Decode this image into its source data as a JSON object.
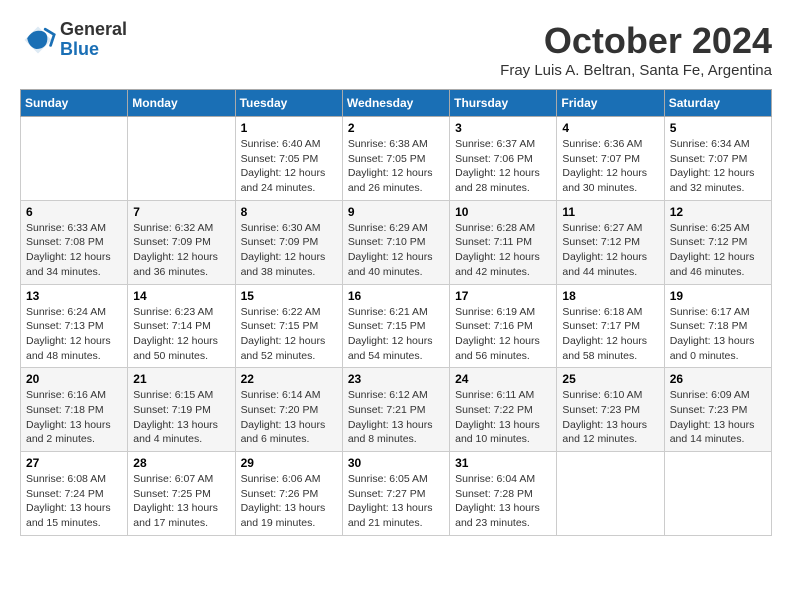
{
  "logo": {
    "general": "General",
    "blue": "Blue"
  },
  "title": "October 2024",
  "location": "Fray Luis A. Beltran, Santa Fe, Argentina",
  "days_of_week": [
    "Sunday",
    "Monday",
    "Tuesday",
    "Wednesday",
    "Thursday",
    "Friday",
    "Saturday"
  ],
  "weeks": [
    [
      {
        "day": null
      },
      {
        "day": null
      },
      {
        "day": "1",
        "sunrise": "Sunrise: 6:40 AM",
        "sunset": "Sunset: 7:05 PM",
        "daylight": "Daylight: 12 hours and 24 minutes."
      },
      {
        "day": "2",
        "sunrise": "Sunrise: 6:38 AM",
        "sunset": "Sunset: 7:05 PM",
        "daylight": "Daylight: 12 hours and 26 minutes."
      },
      {
        "day": "3",
        "sunrise": "Sunrise: 6:37 AM",
        "sunset": "Sunset: 7:06 PM",
        "daylight": "Daylight: 12 hours and 28 minutes."
      },
      {
        "day": "4",
        "sunrise": "Sunrise: 6:36 AM",
        "sunset": "Sunset: 7:07 PM",
        "daylight": "Daylight: 12 hours and 30 minutes."
      },
      {
        "day": "5",
        "sunrise": "Sunrise: 6:34 AM",
        "sunset": "Sunset: 7:07 PM",
        "daylight": "Daylight: 12 hours and 32 minutes."
      }
    ],
    [
      {
        "day": "6",
        "sunrise": "Sunrise: 6:33 AM",
        "sunset": "Sunset: 7:08 PM",
        "daylight": "Daylight: 12 hours and 34 minutes."
      },
      {
        "day": "7",
        "sunrise": "Sunrise: 6:32 AM",
        "sunset": "Sunset: 7:09 PM",
        "daylight": "Daylight: 12 hours and 36 minutes."
      },
      {
        "day": "8",
        "sunrise": "Sunrise: 6:30 AM",
        "sunset": "Sunset: 7:09 PM",
        "daylight": "Daylight: 12 hours and 38 minutes."
      },
      {
        "day": "9",
        "sunrise": "Sunrise: 6:29 AM",
        "sunset": "Sunset: 7:10 PM",
        "daylight": "Daylight: 12 hours and 40 minutes."
      },
      {
        "day": "10",
        "sunrise": "Sunrise: 6:28 AM",
        "sunset": "Sunset: 7:11 PM",
        "daylight": "Daylight: 12 hours and 42 minutes."
      },
      {
        "day": "11",
        "sunrise": "Sunrise: 6:27 AM",
        "sunset": "Sunset: 7:12 PM",
        "daylight": "Daylight: 12 hours and 44 minutes."
      },
      {
        "day": "12",
        "sunrise": "Sunrise: 6:25 AM",
        "sunset": "Sunset: 7:12 PM",
        "daylight": "Daylight: 12 hours and 46 minutes."
      }
    ],
    [
      {
        "day": "13",
        "sunrise": "Sunrise: 6:24 AM",
        "sunset": "Sunset: 7:13 PM",
        "daylight": "Daylight: 12 hours and 48 minutes."
      },
      {
        "day": "14",
        "sunrise": "Sunrise: 6:23 AM",
        "sunset": "Sunset: 7:14 PM",
        "daylight": "Daylight: 12 hours and 50 minutes."
      },
      {
        "day": "15",
        "sunrise": "Sunrise: 6:22 AM",
        "sunset": "Sunset: 7:15 PM",
        "daylight": "Daylight: 12 hours and 52 minutes."
      },
      {
        "day": "16",
        "sunrise": "Sunrise: 6:21 AM",
        "sunset": "Sunset: 7:15 PM",
        "daylight": "Daylight: 12 hours and 54 minutes."
      },
      {
        "day": "17",
        "sunrise": "Sunrise: 6:19 AM",
        "sunset": "Sunset: 7:16 PM",
        "daylight": "Daylight: 12 hours and 56 minutes."
      },
      {
        "day": "18",
        "sunrise": "Sunrise: 6:18 AM",
        "sunset": "Sunset: 7:17 PM",
        "daylight": "Daylight: 12 hours and 58 minutes."
      },
      {
        "day": "19",
        "sunrise": "Sunrise: 6:17 AM",
        "sunset": "Sunset: 7:18 PM",
        "daylight": "Daylight: 13 hours and 0 minutes."
      }
    ],
    [
      {
        "day": "20",
        "sunrise": "Sunrise: 6:16 AM",
        "sunset": "Sunset: 7:18 PM",
        "daylight": "Daylight: 13 hours and 2 minutes."
      },
      {
        "day": "21",
        "sunrise": "Sunrise: 6:15 AM",
        "sunset": "Sunset: 7:19 PM",
        "daylight": "Daylight: 13 hours and 4 minutes."
      },
      {
        "day": "22",
        "sunrise": "Sunrise: 6:14 AM",
        "sunset": "Sunset: 7:20 PM",
        "daylight": "Daylight: 13 hours and 6 minutes."
      },
      {
        "day": "23",
        "sunrise": "Sunrise: 6:12 AM",
        "sunset": "Sunset: 7:21 PM",
        "daylight": "Daylight: 13 hours and 8 minutes."
      },
      {
        "day": "24",
        "sunrise": "Sunrise: 6:11 AM",
        "sunset": "Sunset: 7:22 PM",
        "daylight": "Daylight: 13 hours and 10 minutes."
      },
      {
        "day": "25",
        "sunrise": "Sunrise: 6:10 AM",
        "sunset": "Sunset: 7:23 PM",
        "daylight": "Daylight: 13 hours and 12 minutes."
      },
      {
        "day": "26",
        "sunrise": "Sunrise: 6:09 AM",
        "sunset": "Sunset: 7:23 PM",
        "daylight": "Daylight: 13 hours and 14 minutes."
      }
    ],
    [
      {
        "day": "27",
        "sunrise": "Sunrise: 6:08 AM",
        "sunset": "Sunset: 7:24 PM",
        "daylight": "Daylight: 13 hours and 15 minutes."
      },
      {
        "day": "28",
        "sunrise": "Sunrise: 6:07 AM",
        "sunset": "Sunset: 7:25 PM",
        "daylight": "Daylight: 13 hours and 17 minutes."
      },
      {
        "day": "29",
        "sunrise": "Sunrise: 6:06 AM",
        "sunset": "Sunset: 7:26 PM",
        "daylight": "Daylight: 13 hours and 19 minutes."
      },
      {
        "day": "30",
        "sunrise": "Sunrise: 6:05 AM",
        "sunset": "Sunset: 7:27 PM",
        "daylight": "Daylight: 13 hours and 21 minutes."
      },
      {
        "day": "31",
        "sunrise": "Sunrise: 6:04 AM",
        "sunset": "Sunset: 7:28 PM",
        "daylight": "Daylight: 13 hours and 23 minutes."
      },
      {
        "day": null
      },
      {
        "day": null
      }
    ]
  ]
}
